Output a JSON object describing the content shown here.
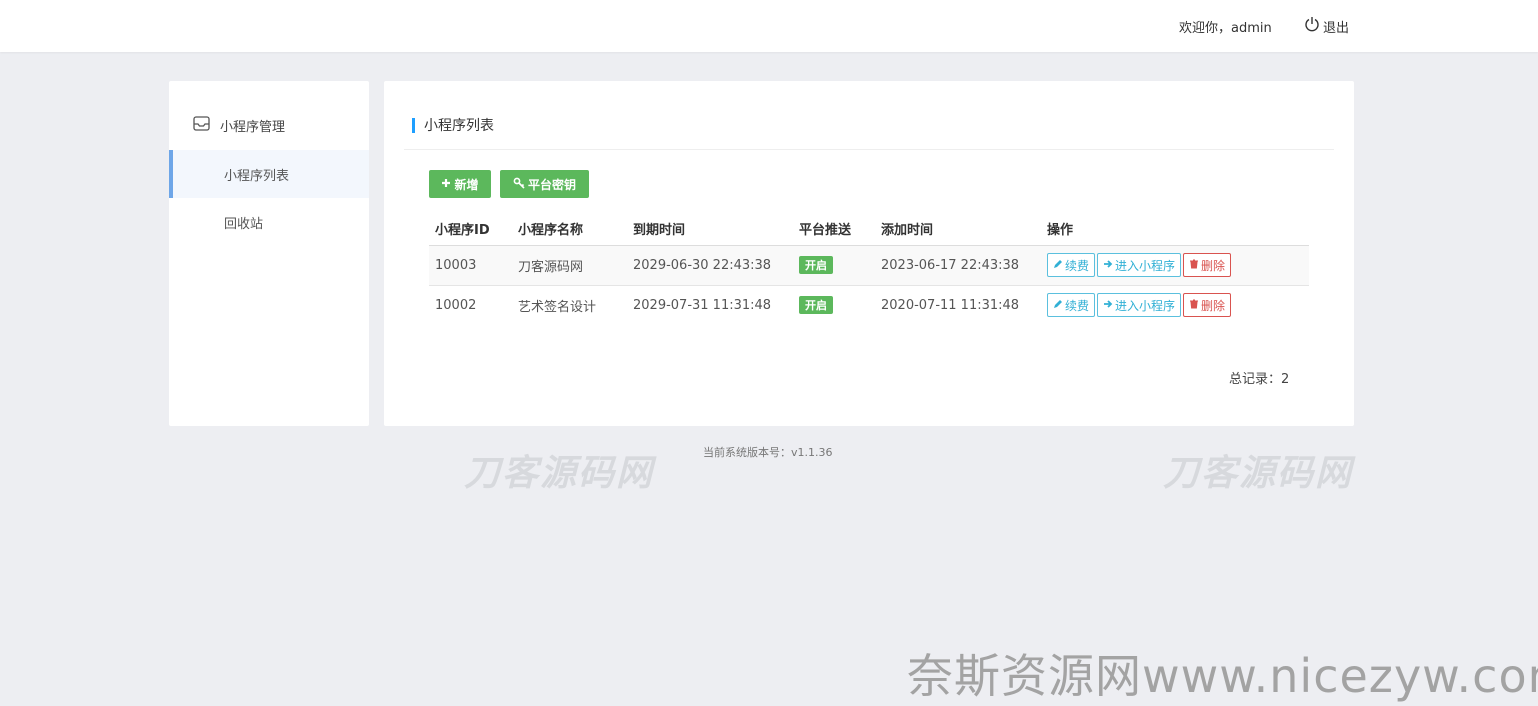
{
  "header": {
    "welcome": "欢迎你，admin",
    "logout_label": "退出"
  },
  "sidebar": {
    "group_label": "小程序管理",
    "items": [
      {
        "label": "小程序列表",
        "active": true
      },
      {
        "label": "回收站",
        "active": false
      }
    ]
  },
  "main": {
    "title": "小程序列表",
    "toolbar": {
      "add_label": "新增",
      "key_label": "平台密钥"
    },
    "table": {
      "headers": [
        "小程序ID",
        "小程序名称",
        "到期时间",
        "平台推送",
        "添加时间",
        "操作"
      ],
      "rows": [
        {
          "id": "10003",
          "name": "刀客源码网",
          "expire": "2029-06-30 22:43:38",
          "push": "开启",
          "added": "2023-06-17 22:43:38"
        },
        {
          "id": "10002",
          "name": "艺术签名设计",
          "expire": "2029-07-31 11:31:48",
          "push": "开启",
          "added": "2020-07-11 11:31:48"
        }
      ],
      "actions": {
        "renew": "续费",
        "enter": "进入小程序",
        "delete": "删除"
      }
    },
    "total": "总记录：2"
  },
  "footer": {
    "version": "当前系统版本号：v1.1.36"
  },
  "watermarks": {
    "logo_left": "刀客源码网",
    "logo_right": "刀客源码网",
    "bottom": "奈斯资源网www.nicezyw.com"
  },
  "colors": {
    "accent": "#1e9fff",
    "success": "#5cb85c",
    "info": "#5bc0de",
    "danger": "#d9534f",
    "active_border": "#6ea6e8"
  }
}
